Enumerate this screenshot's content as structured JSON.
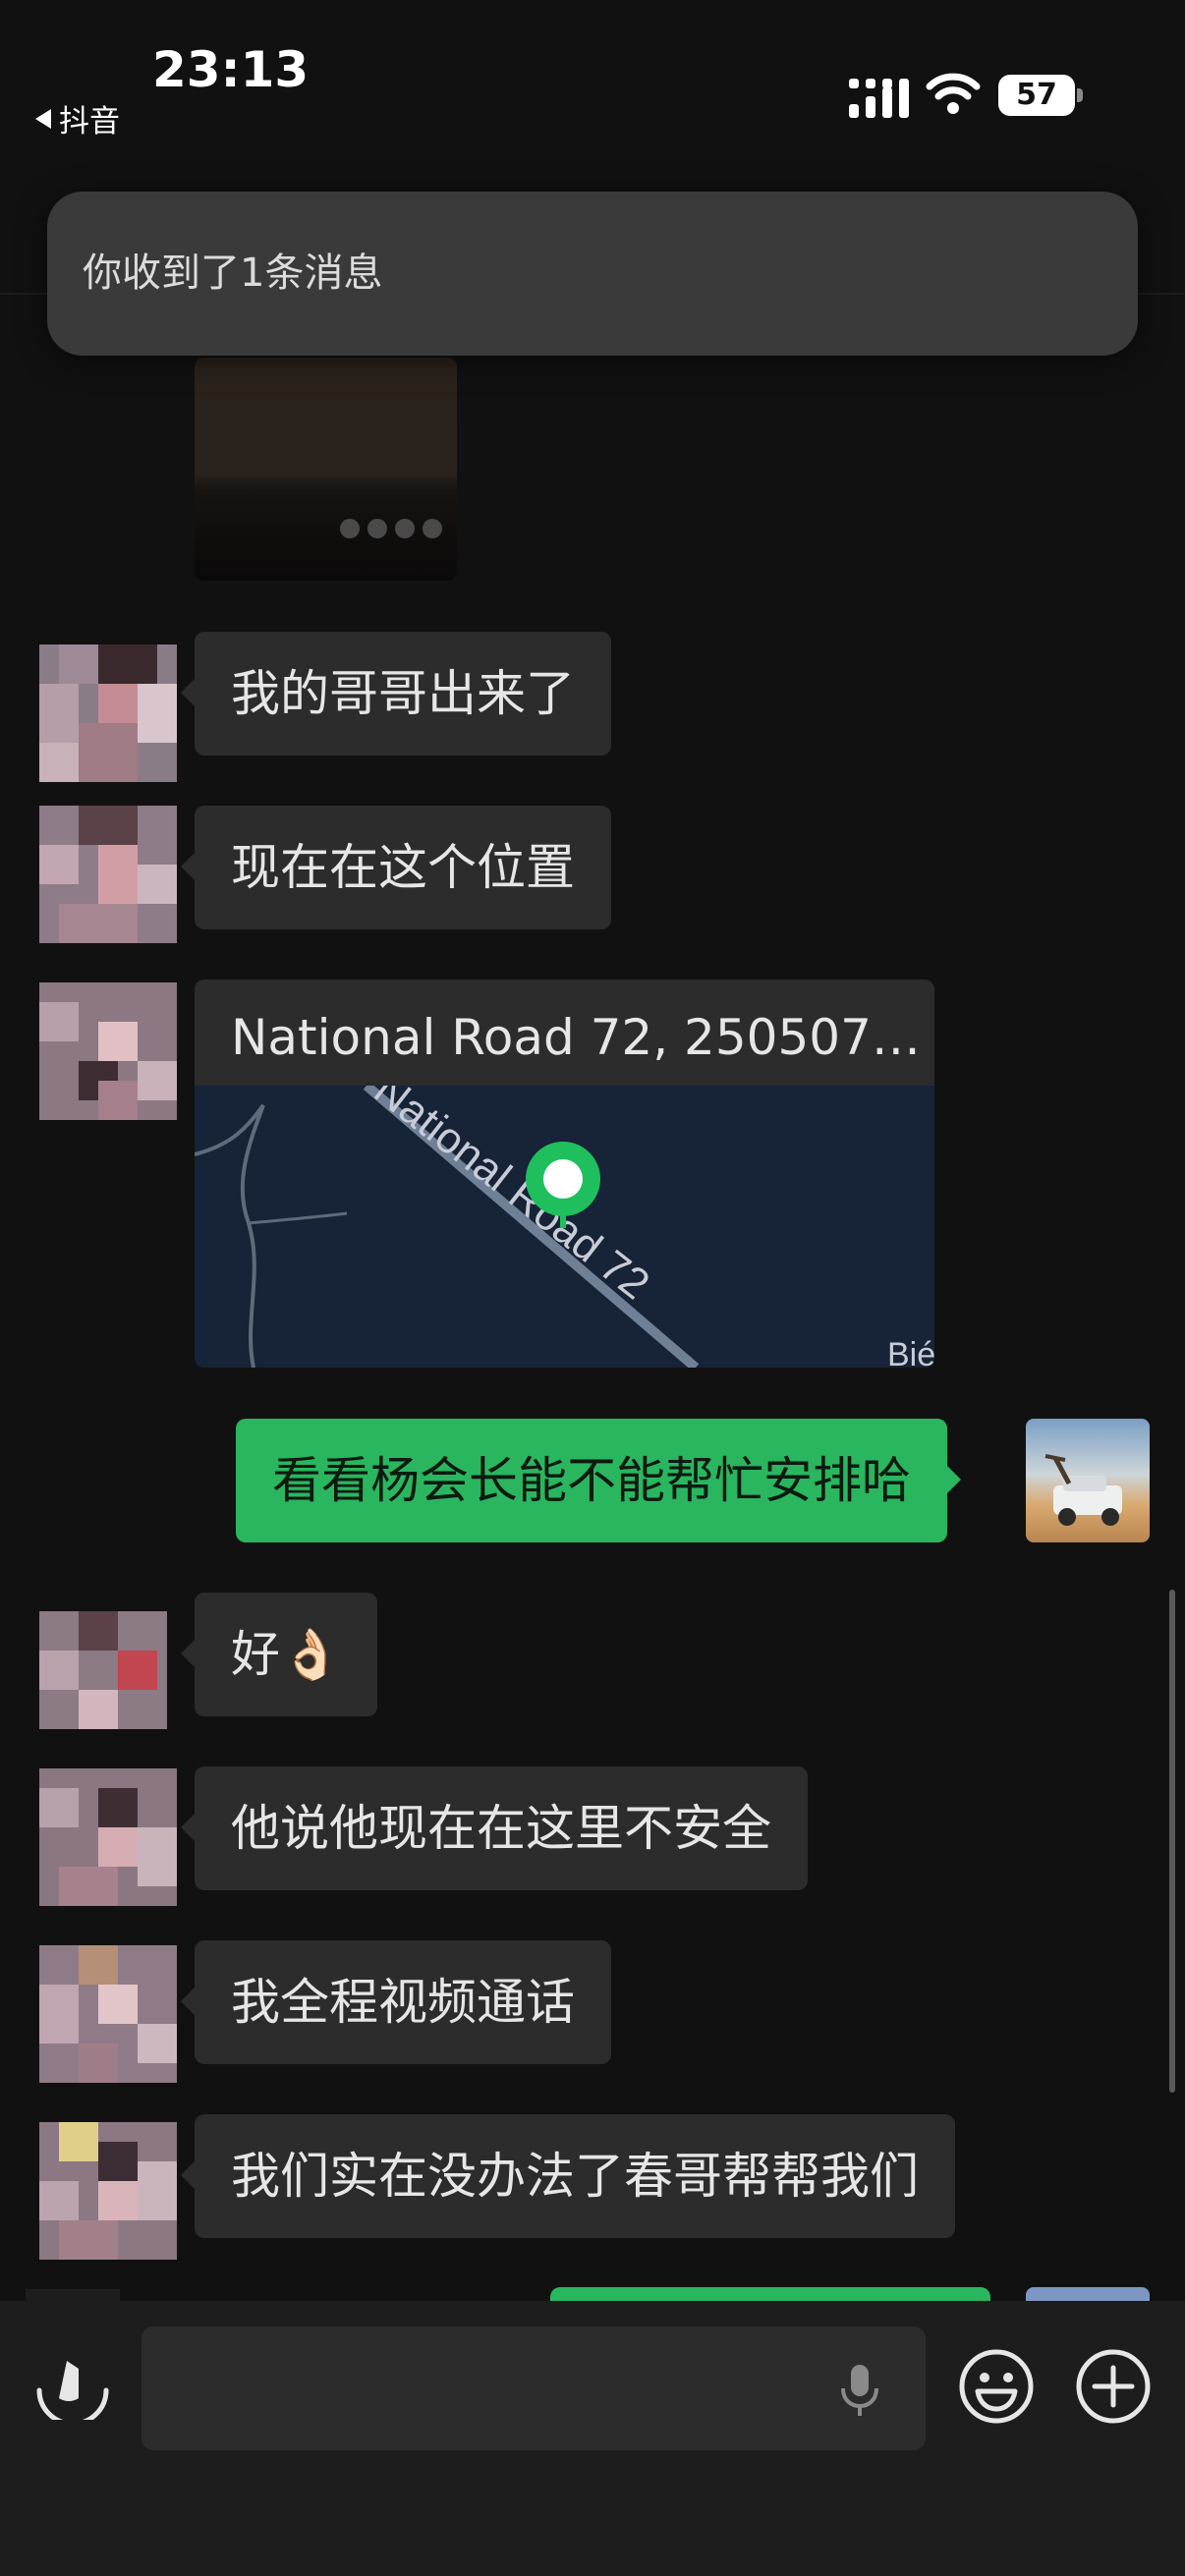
{
  "status_bar": {
    "time": "23:13",
    "back_app": "抖音",
    "battery": "57"
  },
  "notification": {
    "text": "你收到了1条消息"
  },
  "messages": [
    {
      "side": "left",
      "type": "text",
      "text": "我的哥哥出来了"
    },
    {
      "side": "left",
      "type": "text",
      "text": "现在在这个位置"
    },
    {
      "side": "left",
      "type": "location",
      "title": "National Road 72, 250507…",
      "map_road": "National Road 72",
      "map_corner": "Bié"
    },
    {
      "side": "right",
      "type": "text",
      "text": "看看杨会长能不能帮忙安排哈"
    },
    {
      "side": "left",
      "type": "text",
      "text": "好👌🏻"
    },
    {
      "side": "left",
      "type": "text",
      "text": "他说他现在在这里不安全"
    },
    {
      "side": "left",
      "type": "text",
      "text": "我全程视频通话"
    },
    {
      "side": "left",
      "type": "text",
      "text": "我们实在没办法了春哥帮帮我们"
    }
  ],
  "colors": {
    "background": "#111111",
    "bubble_incoming": "#2c2c2c",
    "bubble_outgoing": "#2ab55f",
    "map_pin": "#1fbf5e",
    "input_bar": "#1d1d1d"
  },
  "icons": {
    "back": "back-arrow-icon",
    "signal": "cellular-signal-icon",
    "wifi": "wifi-icon",
    "battery": "battery-icon",
    "voice": "voice-toggle-icon",
    "mic": "microphone-icon",
    "emoji": "emoji-icon",
    "plus": "plus-icon",
    "pin": "map-pin-icon"
  }
}
